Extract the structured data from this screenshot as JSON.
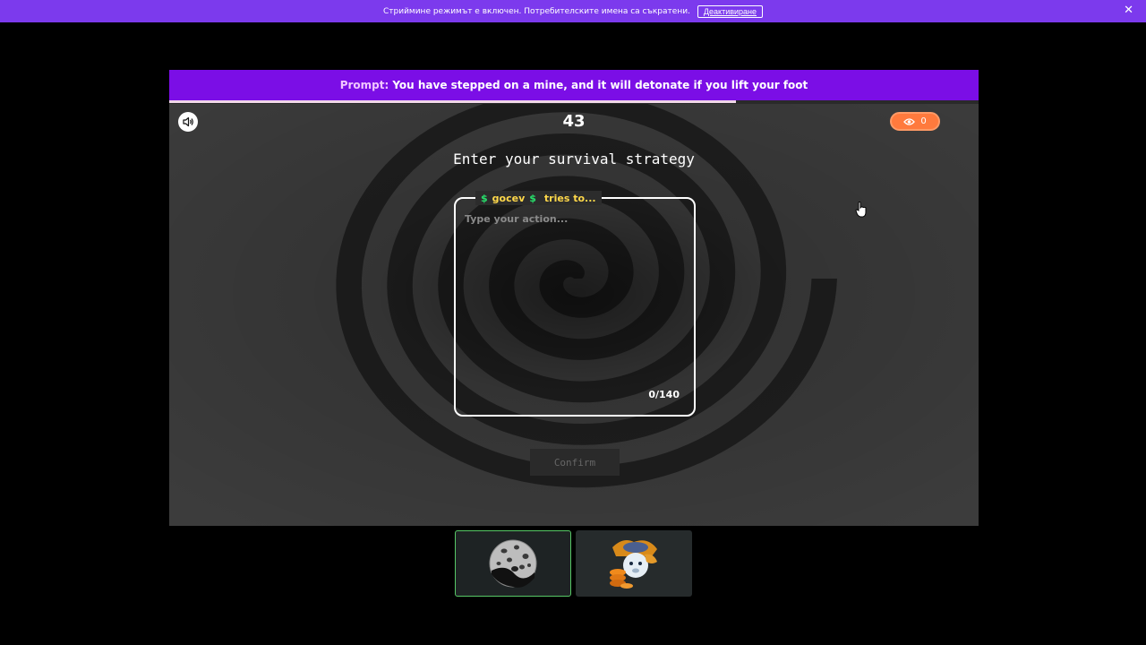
{
  "stream_bar": {
    "message": "Стриймине режимът е включен. Потребителските имена са съкратени.",
    "deactivate_label": "Деактивиране",
    "close_glyph": "✕"
  },
  "game": {
    "prompt_label": "Prompt:",
    "prompt_text": "You have stepped on a mine, and it will detonate if you lift your foot",
    "timer_progress": 0.7,
    "countdown": "43",
    "viewer_count": "0",
    "headline": "Enter your survival strategy",
    "action": {
      "dollar_sign": "$",
      "player_name": "gocev",
      "tries_label": "tries to...",
      "placeholder": "Type your action...",
      "value": "",
      "char_count": "0/140"
    },
    "confirm_label": "Confirm"
  },
  "players": [
    {
      "avatar": "cookie-avatar",
      "active": true
    },
    {
      "avatar": "coins-bear-avatar",
      "active": false
    }
  ],
  "icons": {
    "sound": "speaker-icon",
    "viewers": "eye-icon",
    "close": "close-icon"
  },
  "colors": {
    "stream_bar": "#7c3aed",
    "prompt_bar": "#7b0ee6",
    "viewer_badge": "#ff7a3d",
    "player_name": "#ffd84a",
    "dollar": "#27e06b",
    "active_player_border": "#57c866"
  }
}
